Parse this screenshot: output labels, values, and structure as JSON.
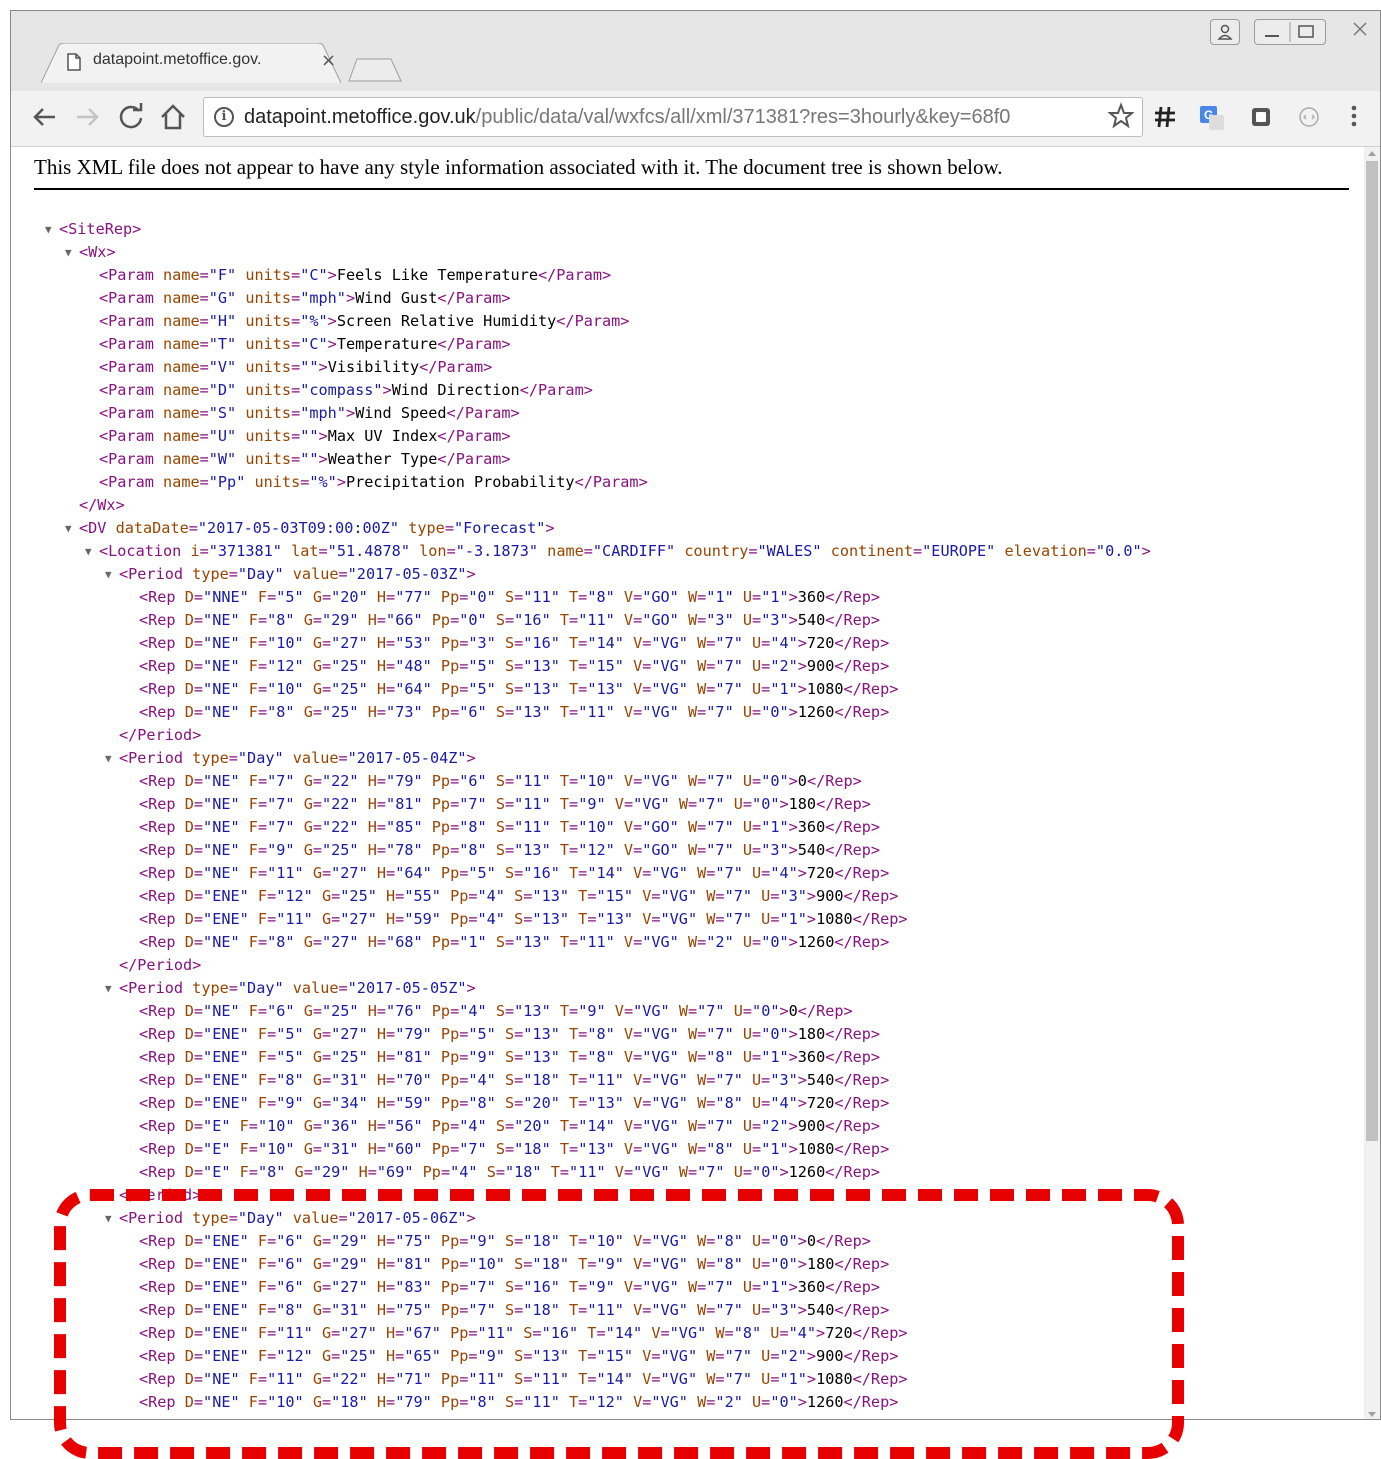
{
  "browser": {
    "tab_title": "datapoint.metoffice.gov.",
    "tab_close": "×",
    "url_domain": "datapoint.metoffice.gov.uk",
    "url_path": "/public/data/val/wxfcs/all/xml/371381?res=3hourly&key=68f0",
    "extensions": [
      "hash-icon",
      "translate-icon",
      "square-icon",
      "circle-icon"
    ]
  },
  "page": {
    "notice": "This XML file does not appear to have any style information associated with it. The document tree is shown below."
  },
  "xml": {
    "root": "SiteRep",
    "wx_tag": "Wx",
    "params": [
      {
        "name": "F",
        "units": "C",
        "text": "Feels Like Temperature"
      },
      {
        "name": "G",
        "units": "mph",
        "text": "Wind Gust"
      },
      {
        "name": "H",
        "units": "%",
        "text": "Screen Relative Humidity"
      },
      {
        "name": "T",
        "units": "C",
        "text": "Temperature"
      },
      {
        "name": "V",
        "units": "",
        "text": "Visibility"
      },
      {
        "name": "D",
        "units": "compass",
        "text": "Wind Direction"
      },
      {
        "name": "S",
        "units": "mph",
        "text": "Wind Speed"
      },
      {
        "name": "U",
        "units": "",
        "text": "Max UV Index"
      },
      {
        "name": "W",
        "units": "",
        "text": "Weather Type"
      },
      {
        "name": "Pp",
        "units": "%",
        "text": "Precipitation Probability"
      }
    ],
    "dv": {
      "dataDate": "2017-05-03T09:00:00Z",
      "type": "Forecast"
    },
    "location": {
      "i": "371381",
      "lat": "51.4878",
      "lon": "-3.1873",
      "name": "CARDIFF",
      "country": "WALES",
      "continent": "EUROPE",
      "elevation": "0.0"
    },
    "periods": [
      {
        "type": "Day",
        "value": "2017-05-03Z",
        "reps": [
          {
            "D": "NNE",
            "F": "5",
            "G": "20",
            "H": "77",
            "Pp": "0",
            "S": "11",
            "T": "8",
            "V": "GO",
            "W": "1",
            "U": "1",
            "text": "360"
          },
          {
            "D": "NE",
            "F": "8",
            "G": "29",
            "H": "66",
            "Pp": "0",
            "S": "16",
            "T": "11",
            "V": "GO",
            "W": "3",
            "U": "3",
            "text": "540"
          },
          {
            "D": "NE",
            "F": "10",
            "G": "27",
            "H": "53",
            "Pp": "3",
            "S": "16",
            "T": "14",
            "V": "VG",
            "W": "7",
            "U": "4",
            "text": "720"
          },
          {
            "D": "NE",
            "F": "12",
            "G": "25",
            "H": "48",
            "Pp": "5",
            "S": "13",
            "T": "15",
            "V": "VG",
            "W": "7",
            "U": "2",
            "text": "900"
          },
          {
            "D": "NE",
            "F": "10",
            "G": "25",
            "H": "64",
            "Pp": "5",
            "S": "13",
            "T": "13",
            "V": "VG",
            "W": "7",
            "U": "1",
            "text": "1080"
          },
          {
            "D": "NE",
            "F": "8",
            "G": "25",
            "H": "73",
            "Pp": "6",
            "S": "13",
            "T": "11",
            "V": "VG",
            "W": "7",
            "U": "0",
            "text": "1260"
          }
        ]
      },
      {
        "type": "Day",
        "value": "2017-05-04Z",
        "reps": [
          {
            "D": "NE",
            "F": "7",
            "G": "22",
            "H": "79",
            "Pp": "6",
            "S": "11",
            "T": "10",
            "V": "VG",
            "W": "7",
            "U": "0",
            "text": "0"
          },
          {
            "D": "NE",
            "F": "7",
            "G": "22",
            "H": "81",
            "Pp": "7",
            "S": "11",
            "T": "9",
            "V": "VG",
            "W": "7",
            "U": "0",
            "text": "180"
          },
          {
            "D": "NE",
            "F": "7",
            "G": "22",
            "H": "85",
            "Pp": "8",
            "S": "11",
            "T": "10",
            "V": "GO",
            "W": "7",
            "U": "1",
            "text": "360"
          },
          {
            "D": "NE",
            "F": "9",
            "G": "25",
            "H": "78",
            "Pp": "8",
            "S": "13",
            "T": "12",
            "V": "GO",
            "W": "7",
            "U": "3",
            "text": "540"
          },
          {
            "D": "NE",
            "F": "11",
            "G": "27",
            "H": "64",
            "Pp": "5",
            "S": "16",
            "T": "14",
            "V": "VG",
            "W": "7",
            "U": "4",
            "text": "720"
          },
          {
            "D": "ENE",
            "F": "12",
            "G": "25",
            "H": "55",
            "Pp": "4",
            "S": "13",
            "T": "15",
            "V": "VG",
            "W": "7",
            "U": "3",
            "text": "900"
          },
          {
            "D": "ENE",
            "F": "11",
            "G": "27",
            "H": "59",
            "Pp": "4",
            "S": "13",
            "T": "13",
            "V": "VG",
            "W": "7",
            "U": "1",
            "text": "1080"
          },
          {
            "D": "NE",
            "F": "8",
            "G": "27",
            "H": "68",
            "Pp": "1",
            "S": "13",
            "T": "11",
            "V": "VG",
            "W": "2",
            "U": "0",
            "text": "1260"
          }
        ]
      },
      {
        "type": "Day",
        "value": "2017-05-05Z",
        "reps": [
          {
            "D": "NE",
            "F": "6",
            "G": "25",
            "H": "76",
            "Pp": "4",
            "S": "13",
            "T": "9",
            "V": "VG",
            "W": "7",
            "U": "0",
            "text": "0"
          },
          {
            "D": "ENE",
            "F": "5",
            "G": "27",
            "H": "79",
            "Pp": "5",
            "S": "13",
            "T": "8",
            "V": "VG",
            "W": "7",
            "U": "0",
            "text": "180"
          },
          {
            "D": "ENE",
            "F": "5",
            "G": "25",
            "H": "81",
            "Pp": "9",
            "S": "13",
            "T": "8",
            "V": "VG",
            "W": "8",
            "U": "1",
            "text": "360"
          },
          {
            "D": "ENE",
            "F": "8",
            "G": "31",
            "H": "70",
            "Pp": "4",
            "S": "18",
            "T": "11",
            "V": "VG",
            "W": "7",
            "U": "3",
            "text": "540"
          },
          {
            "D": "ENE",
            "F": "9",
            "G": "34",
            "H": "59",
            "Pp": "8",
            "S": "20",
            "T": "13",
            "V": "VG",
            "W": "8",
            "U": "4",
            "text": "720"
          },
          {
            "D": "E",
            "F": "10",
            "G": "36",
            "H": "56",
            "Pp": "4",
            "S": "20",
            "T": "14",
            "V": "VG",
            "W": "7",
            "U": "2",
            "text": "900"
          },
          {
            "D": "E",
            "F": "10",
            "G": "31",
            "H": "60",
            "Pp": "7",
            "S": "18",
            "T": "13",
            "V": "VG",
            "W": "8",
            "U": "1",
            "text": "1080"
          },
          {
            "D": "E",
            "F": "8",
            "G": "29",
            "H": "69",
            "Pp": "4",
            "S": "18",
            "T": "11",
            "V": "VG",
            "W": "7",
            "U": "0",
            "text": "1260"
          }
        ]
      },
      {
        "type": "Day",
        "value": "2017-05-06Z",
        "reps": [
          {
            "D": "ENE",
            "F": "6",
            "G": "29",
            "H": "75",
            "Pp": "9",
            "S": "18",
            "T": "10",
            "V": "VG",
            "W": "8",
            "U": "0",
            "text": "0"
          },
          {
            "D": "ENE",
            "F": "6",
            "G": "29",
            "H": "81",
            "Pp": "10",
            "S": "18",
            "T": "9",
            "V": "VG",
            "W": "8",
            "U": "0",
            "text": "180"
          },
          {
            "D": "ENE",
            "F": "6",
            "G": "27",
            "H": "83",
            "Pp": "7",
            "S": "16",
            "T": "9",
            "V": "VG",
            "W": "7",
            "U": "1",
            "text": "360"
          },
          {
            "D": "ENE",
            "F": "8",
            "G": "31",
            "H": "75",
            "Pp": "7",
            "S": "18",
            "T": "11",
            "V": "VG",
            "W": "7",
            "U": "3",
            "text": "540"
          },
          {
            "D": "ENE",
            "F": "11",
            "G": "27",
            "H": "67",
            "Pp": "11",
            "S": "16",
            "T": "14",
            "V": "VG",
            "W": "8",
            "U": "4",
            "text": "720"
          },
          {
            "D": "ENE",
            "F": "12",
            "G": "25",
            "H": "65",
            "Pp": "9",
            "S": "13",
            "T": "15",
            "V": "VG",
            "W": "7",
            "U": "2",
            "text": "900"
          },
          {
            "D": "NE",
            "F": "11",
            "G": "22",
            "H": "71",
            "Pp": "11",
            "S": "11",
            "T": "14",
            "V": "VG",
            "W": "7",
            "U": "1",
            "text": "1080"
          },
          {
            "D": "NE",
            "F": "10",
            "G": "18",
            "H": "79",
            "Pp": "8",
            "S": "11",
            "T": "12",
            "V": "VG",
            "W": "2",
            "U": "0",
            "text": "1260"
          }
        ]
      }
    ]
  },
  "annotation": {
    "color": "#e60000",
    "style": "dashed rounded rectangle"
  }
}
